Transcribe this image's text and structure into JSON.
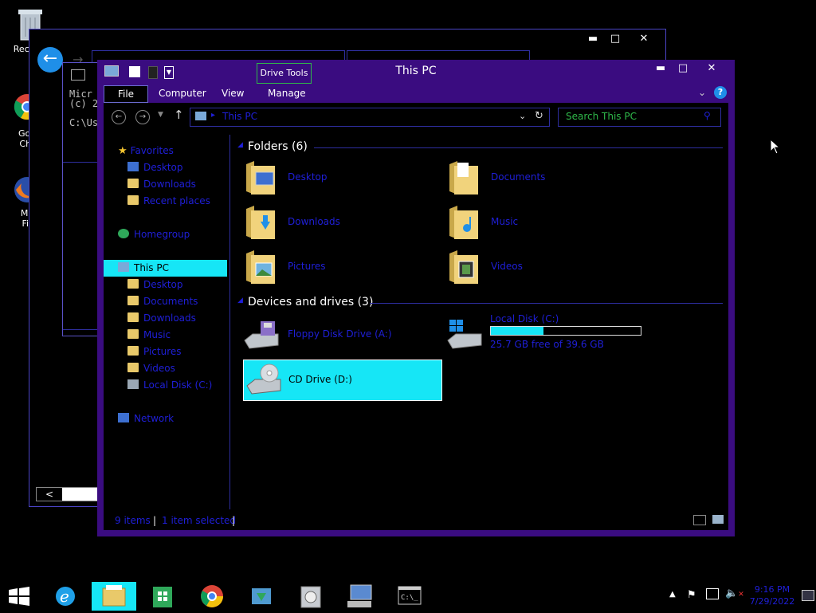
{
  "desktop": {
    "icons": [
      {
        "name": "Recycle Bin",
        "label": "Recyc"
      },
      {
        "name": "Google Chrome",
        "label1": "Goo",
        "label2": "Chr"
      },
      {
        "name": "Mozilla Firefox",
        "label1": "Mo",
        "label2": "Fir"
      }
    ]
  },
  "cmd_window": {
    "line1": "Micr",
    "line2": "(c) 2",
    "line3": "C:\\Us"
  },
  "explorer": {
    "title": "This PC",
    "context_tab": "Drive Tools",
    "ribbon_tabs": [
      "File",
      "Computer",
      "View",
      "Manage"
    ],
    "address": "This PC",
    "search_placeholder": "Search This PC",
    "nav": {
      "favorites": "Favorites",
      "fav_items": [
        "Desktop",
        "Downloads",
        "Recent places"
      ],
      "homegroup": "Homegroup",
      "thispc": "This PC",
      "pc_items": [
        "Desktop",
        "Documents",
        "Downloads",
        "Music",
        "Pictures",
        "Videos",
        "Local Disk (C:)"
      ],
      "network": "Network"
    },
    "folders_header": "Folders (6)",
    "folders": [
      "Desktop",
      "Documents",
      "Downloads",
      "Music",
      "Pictures",
      "Videos"
    ],
    "devices_header": "Devices and drives (3)",
    "drives": {
      "floppy": "Floppy Disk Drive (A:)",
      "local": "Local Disk (C:)",
      "local_free": "25.7 GB free of 39.6 GB",
      "local_used_fraction": 0.35,
      "cd": "CD Drive (D:)"
    },
    "status": {
      "items": "9 items",
      "selected": "1 item selected"
    }
  },
  "taskbar": {
    "time": "9:16 PM",
    "date": "7/29/2022"
  },
  "colors": {
    "frame": "#3a0c80",
    "selection": "#16e6f6",
    "link": "#1f1fd8",
    "search_text": "#2fb84a"
  }
}
